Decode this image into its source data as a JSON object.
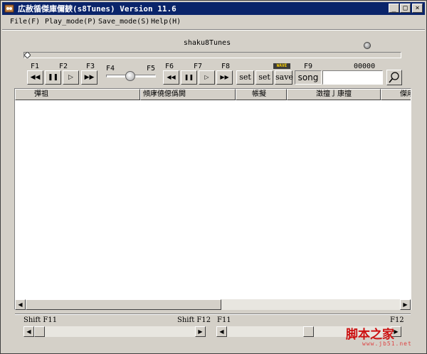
{
  "window": {
    "title": "広赦循傑庫儞斔(s8Tunes) Version 11.6",
    "controls": [
      "_",
      "□",
      "×"
    ]
  },
  "menu": [
    {
      "label": "File(F)"
    },
    {
      "label": "Play_mode(P)"
    },
    {
      "label": "Save_mode(S)"
    },
    {
      "label": "Help(H)"
    }
  ],
  "player": {
    "song_name": "shaku8Tunes",
    "counter": "00000",
    "wave_badge": "WAVE",
    "song_label": "song",
    "search_value": "",
    "fkeys": [
      "F1",
      "F2",
      "F3",
      "F4",
      "F5",
      "F6",
      "F7",
      "F8",
      "F9"
    ],
    "buttons": {
      "prev": "◀◀",
      "pause": "❚❚",
      "play": "▷",
      "next": "▶▶",
      "set1": "set",
      "set2": "set",
      "save": "save"
    }
  },
  "list": {
    "columns": [
      "彈祖",
      "傾庨僥僫僞閧",
      "帳擬",
      "澂擅亅康擅",
      "傑庨"
    ]
  },
  "bottom": {
    "left_label_1": "Shift F11",
    "left_label_2": "Shift F12",
    "right_label_1": "F11",
    "right_label_2": "F12"
  },
  "watermark": {
    "text": "脚本之家",
    "url": "www.jb51.net"
  }
}
